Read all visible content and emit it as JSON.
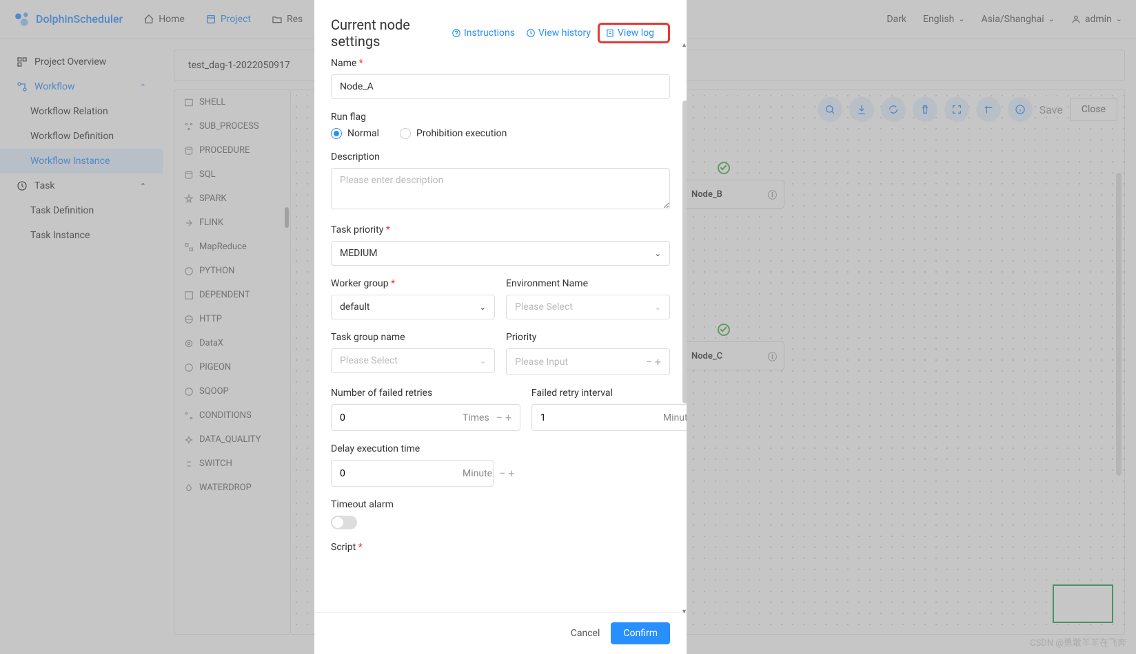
{
  "brand": "DolphinScheduler",
  "nav": {
    "home": "Home",
    "project": "Project",
    "resources": "Res"
  },
  "header": {
    "theme": "Dark",
    "lang": "English",
    "tz": "Asia/Shanghai",
    "user": "admin"
  },
  "sidebar": {
    "overview": "Project Overview",
    "workflow": "Workflow",
    "wf_relation": "Workflow Relation",
    "wf_definition": "Workflow Definition",
    "wf_instance": "Workflow Instance",
    "task": "Task",
    "task_def": "Task Definition",
    "task_inst": "Task Instance"
  },
  "breadcrumb": "test_dag-1-2022050917",
  "tasks": [
    "SHELL",
    "SUB_PROCESS",
    "PROCEDURE",
    "SQL",
    "SPARK",
    "FLINK",
    "MapReduce",
    "PYTHON",
    "DEPENDENT",
    "HTTP",
    "DataX",
    "PIGEON",
    "SQOOP",
    "CONDITIONS",
    "DATA_QUALITY",
    "SWITCH",
    "WATERDROP"
  ],
  "toolbar": {
    "save": "Save",
    "close": "Close"
  },
  "nodes": {
    "b": "Node_B",
    "c": "Node_C"
  },
  "drawer": {
    "title": "Current node settings",
    "instructions": "Instructions",
    "view_history": "View history",
    "view_log": "View log",
    "name_label": "Name",
    "name_value": "Node_A",
    "runflag_label": "Run flag",
    "runflag_normal": "Normal",
    "runflag_prohibit": "Prohibition execution",
    "desc_label": "Description",
    "desc_placeholder": "Please enter description",
    "priority_label": "Task priority",
    "priority_value": "MEDIUM",
    "worker_label": "Worker group",
    "worker_value": "default",
    "env_label": "Environment Name",
    "env_placeholder": "Please Select",
    "taskgroup_label": "Task group name",
    "taskgroup_placeholder": "Please Select",
    "tg_priority_label": "Priority",
    "tg_priority_placeholder": "Please Input",
    "retries_label": "Number of failed retries",
    "retries_value": "0",
    "retries_unit": "Times",
    "interval_label": "Failed retry interval",
    "interval_value": "1",
    "interval_unit": "Minute",
    "delay_label": "Delay execution time",
    "delay_value": "0",
    "delay_unit": "Minute",
    "timeout_label": "Timeout alarm",
    "script_label": "Script",
    "cancel": "Cancel",
    "confirm": "Confirm"
  },
  "watermark": "CSDN @勇敢羊羊在飞奔"
}
